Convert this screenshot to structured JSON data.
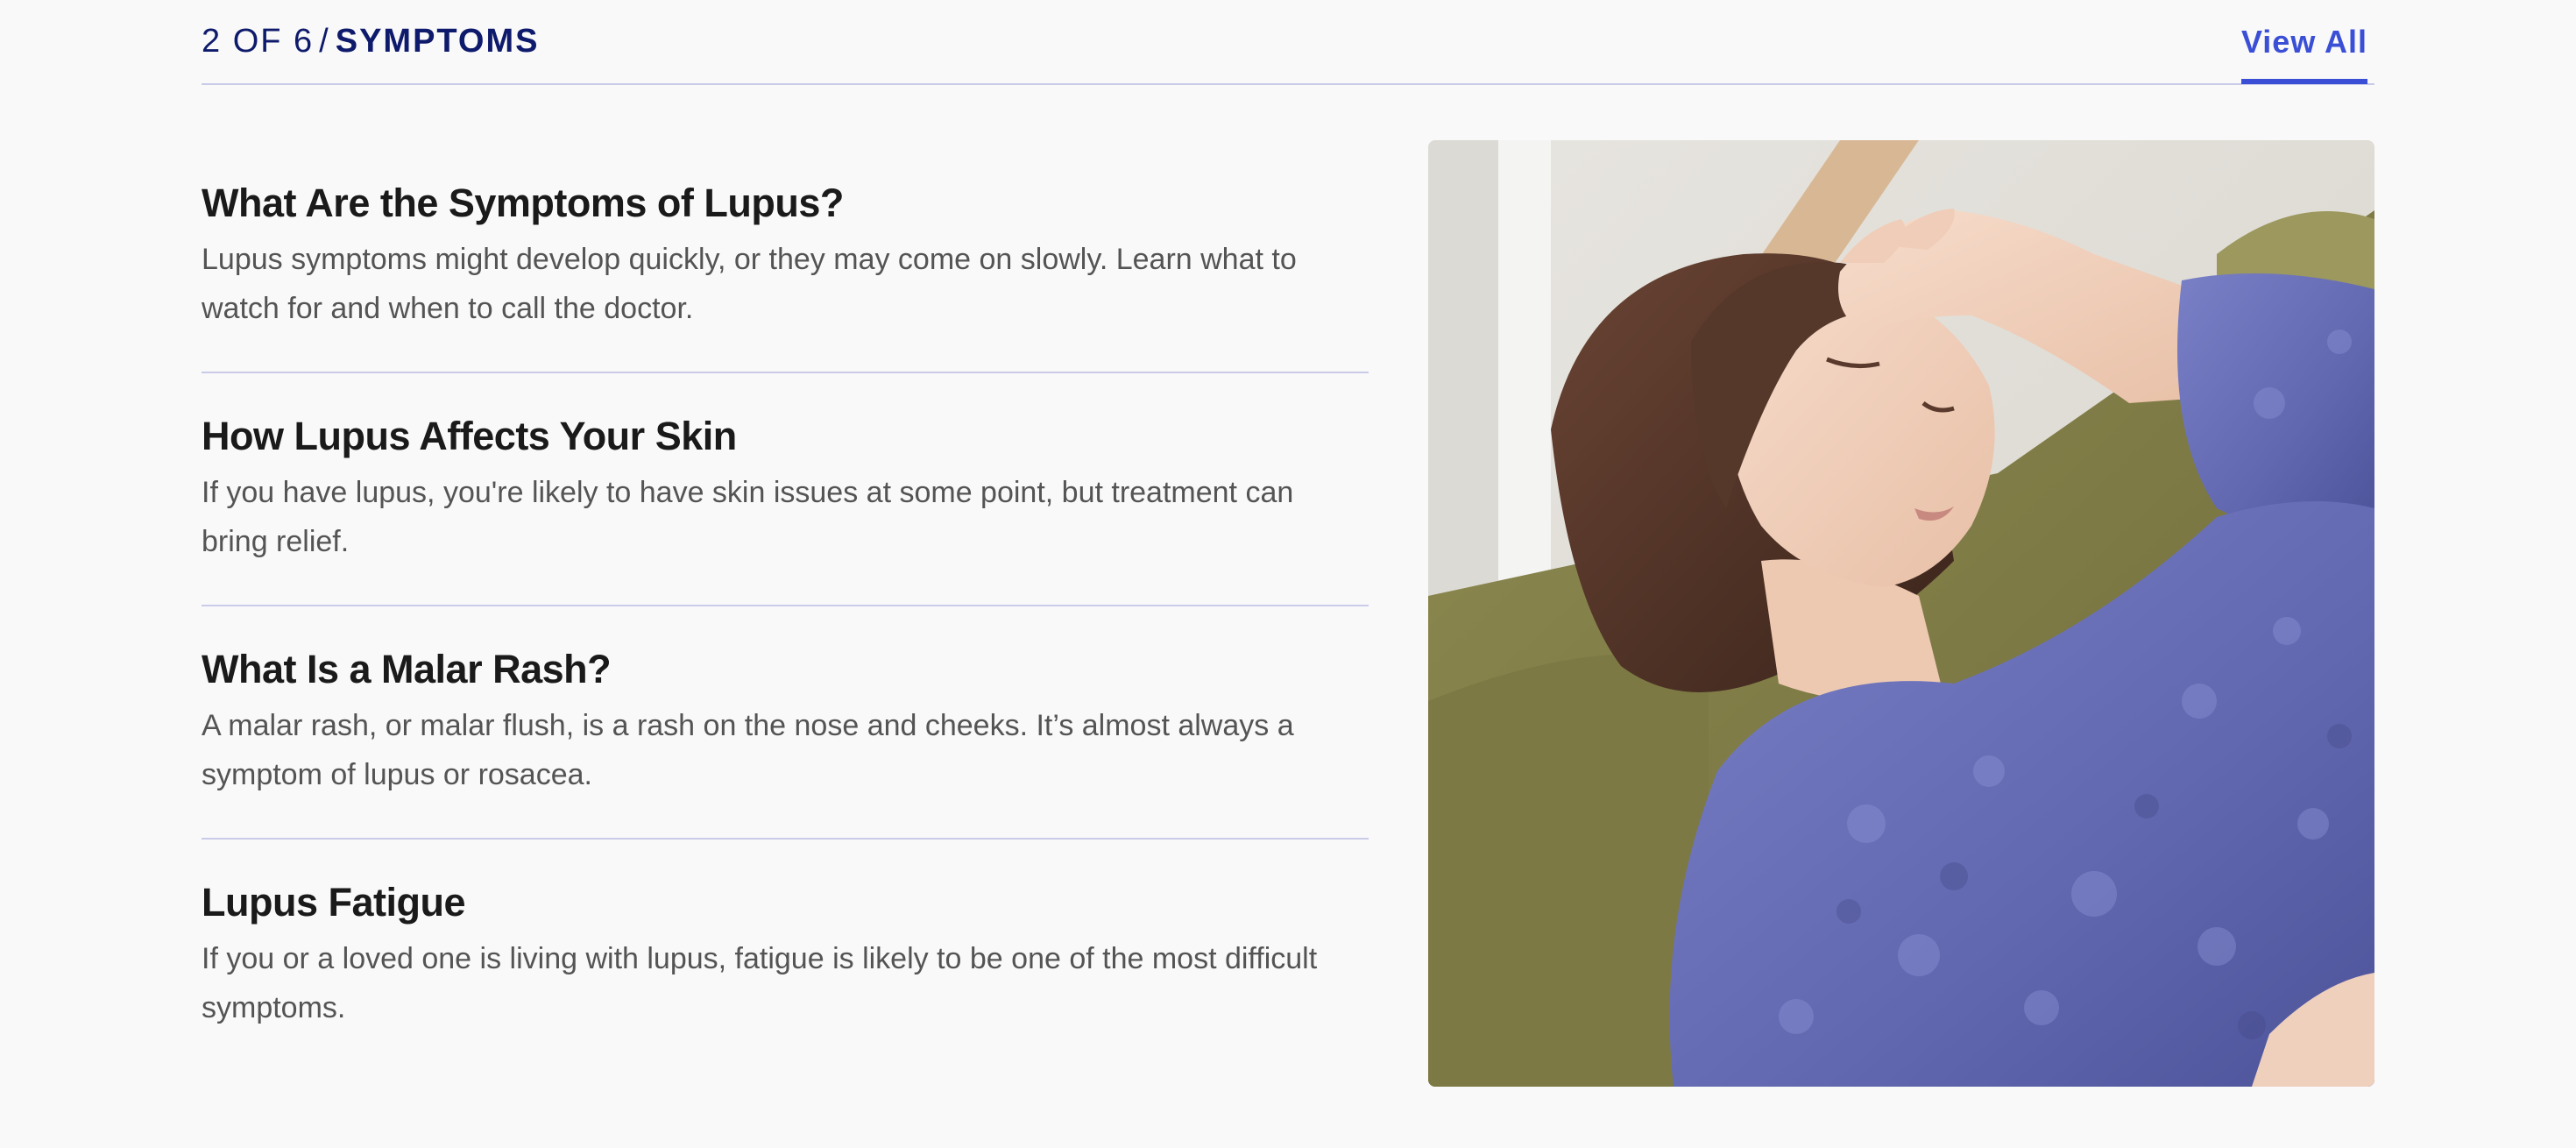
{
  "header": {
    "position_label": "2 OF 6",
    "separator": "/",
    "topic_label": "SYMPTOMS",
    "view_all_label": "View All"
  },
  "articles": [
    {
      "title": "What Are the Symptoms of Lupus?",
      "description": "Lupus symptoms might develop quickly, or they may come on slowly. Learn what to watch for and when to call the doctor."
    },
    {
      "title": "How Lupus Affects Your Skin",
      "description": "If you have lupus, you're likely to have skin issues at some point, but treatment can bring relief."
    },
    {
      "title": "What Is a Malar Rash?",
      "description": "A malar rash, or malar flush, is a rash on the nose and cheeks. It’s almost always a symptom of lupus or rosacea."
    },
    {
      "title": "Lupus Fatigue",
      "description": "If you or a loved one is living with lupus, fatigue is likely to be one of the most difficult symptoms."
    }
  ],
  "colors": {
    "accent": "#3a4fd6",
    "heading_navy": "#0e1a6b",
    "divider": "#c9cbe8",
    "background": "#f9f9f9"
  }
}
